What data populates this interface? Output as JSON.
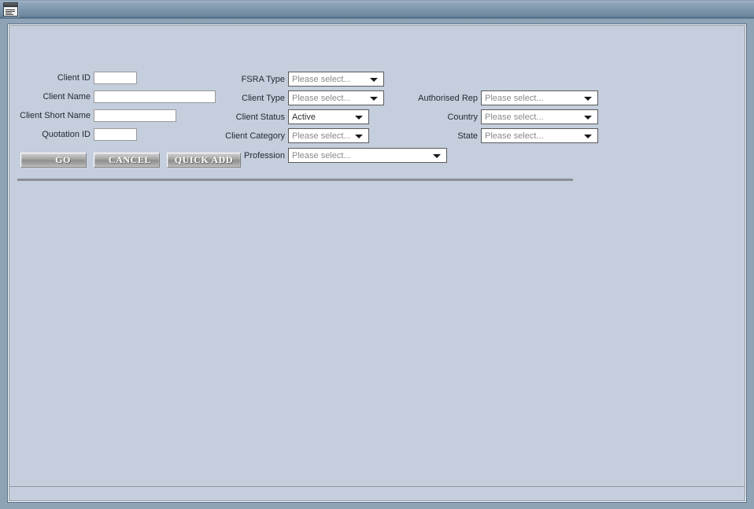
{
  "window": {
    "icon_name": "application-window-icon",
    "title": ""
  },
  "form": {
    "column_left": [
      {
        "label": "Client ID",
        "value": "",
        "placeholder": ""
      },
      {
        "label": "Client Name",
        "value": "",
        "placeholder": ""
      },
      {
        "label": "Client Short Name",
        "value": "",
        "placeholder": ""
      },
      {
        "label": "Quotation ID",
        "value": "",
        "placeholder": ""
      }
    ],
    "column_middle": [
      {
        "label": "FSRA Type",
        "value": "Please select...",
        "selected": false
      },
      {
        "label": "Client Type",
        "value": "Please select...",
        "selected": false
      },
      {
        "label": "Client Status",
        "value": "Active",
        "selected": true
      },
      {
        "label": "Client Category",
        "value": "Please select...",
        "selected": false
      },
      {
        "label": "Profession",
        "value": "Please select...",
        "selected": false
      }
    ],
    "column_right": [
      {
        "label": "Authorised Rep",
        "value": "Please select...",
        "selected": false
      },
      {
        "label": "Country",
        "value": "Please select...",
        "selected": false
      },
      {
        "label": "State",
        "value": "Please select...",
        "selected": false
      }
    ]
  },
  "buttons": {
    "go": "GO",
    "cancel": "CANCEL",
    "quick_add": "QUICK ADD"
  },
  "colors": {
    "titlebar_top": "#8ba0b5",
    "titlebar_bottom": "#3f5d74",
    "panel_background": "#c4cedd",
    "divider": "#8b8f96",
    "label_text": "#222b33",
    "placeholder_text": "#8a8a8a"
  }
}
